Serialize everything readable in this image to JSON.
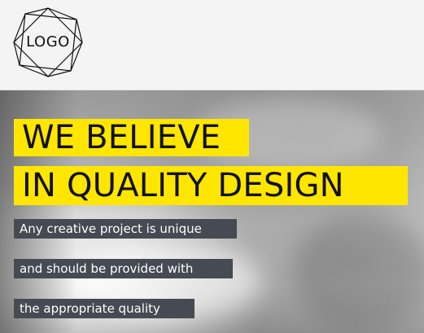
{
  "header": {
    "logo_text": "LOGO"
  },
  "hero": {
    "headline_line_1": "WE BELIEVE",
    "headline_line_2": "IN QUALITY DESIGN",
    "tagline_lines": [
      "Any creative project is unique",
      "and should be provided with",
      "the appropriate quality"
    ]
  },
  "colors": {
    "accent_yellow": "#ffe600",
    "tag_background": "#454a53",
    "header_background": "#f4f4f4"
  },
  "icons": {
    "logo": "octagram-outline-logo"
  }
}
